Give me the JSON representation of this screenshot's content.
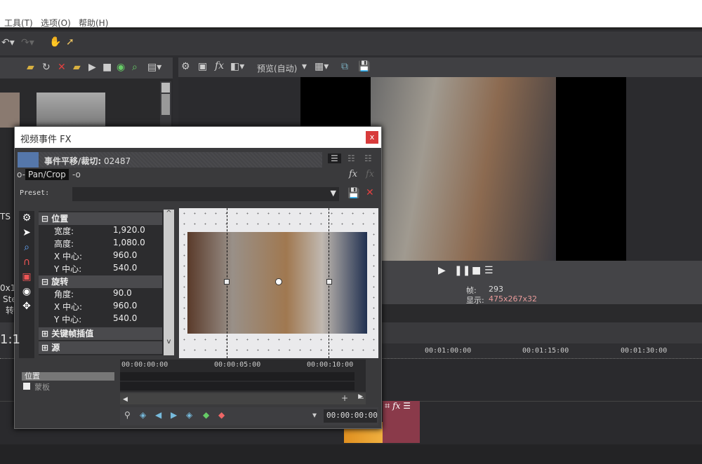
{
  "menu": {
    "items": [
      "工具(T)",
      "选项(O)",
      "帮助(H)"
    ]
  },
  "left_panel": {
    "fragments": [
      "TS",
      "0x1",
      "Ste",
      "转",
      "1:1"
    ]
  },
  "preview_toolbar": {
    "preview_mode": "预览(自动)"
  },
  "preview_info": {
    "frame_label": "帧:",
    "frame_value": "293",
    "display_label": "显示:",
    "display_value": "475x267x32"
  },
  "timeline": {
    "ruler": [
      "00:01:00:00",
      "00:01:15:00",
      "00:01:30:00"
    ]
  },
  "dialog": {
    "title": "视频事件 FX",
    "close": "x",
    "chain_title": "事件平移/裁切:",
    "chain_id": "02487",
    "plugin": "Pan/Crop",
    "preset_label": "Preset:",
    "preset_value": "",
    "sections": [
      {
        "label": "位置",
        "expanded": true,
        "props": [
          {
            "k": "宽度:",
            "v": "1,920.0"
          },
          {
            "k": "高度:",
            "v": "1,080.0"
          },
          {
            "k": "X 中心:",
            "v": "960.0"
          },
          {
            "k": "Y 中心:",
            "v": "540.0"
          }
        ]
      },
      {
        "label": "旋转",
        "expanded": true,
        "props": [
          {
            "k": "角度:",
            "v": "90.0"
          },
          {
            "k": "X 中心:",
            "v": "960.0"
          },
          {
            "k": "Y 中心:",
            "v": "540.0"
          }
        ]
      },
      {
        "label": "关键帧插值",
        "expanded": false
      },
      {
        "label": "源",
        "expanded": false
      }
    ],
    "keyframe_tracks": [
      {
        "label": "位置",
        "checked": null
      },
      {
        "label": "蒙板",
        "checked": false
      }
    ],
    "kf_ruler": [
      "00:00:00:00",
      "00:00:05:00",
      "00:00:10:00"
    ],
    "cursor_time": "00:00:00:00"
  },
  "colors": {
    "accent_red": "#d83b3b",
    "event_clip": "#8a3a4a",
    "display_value": "#e89a9a"
  }
}
